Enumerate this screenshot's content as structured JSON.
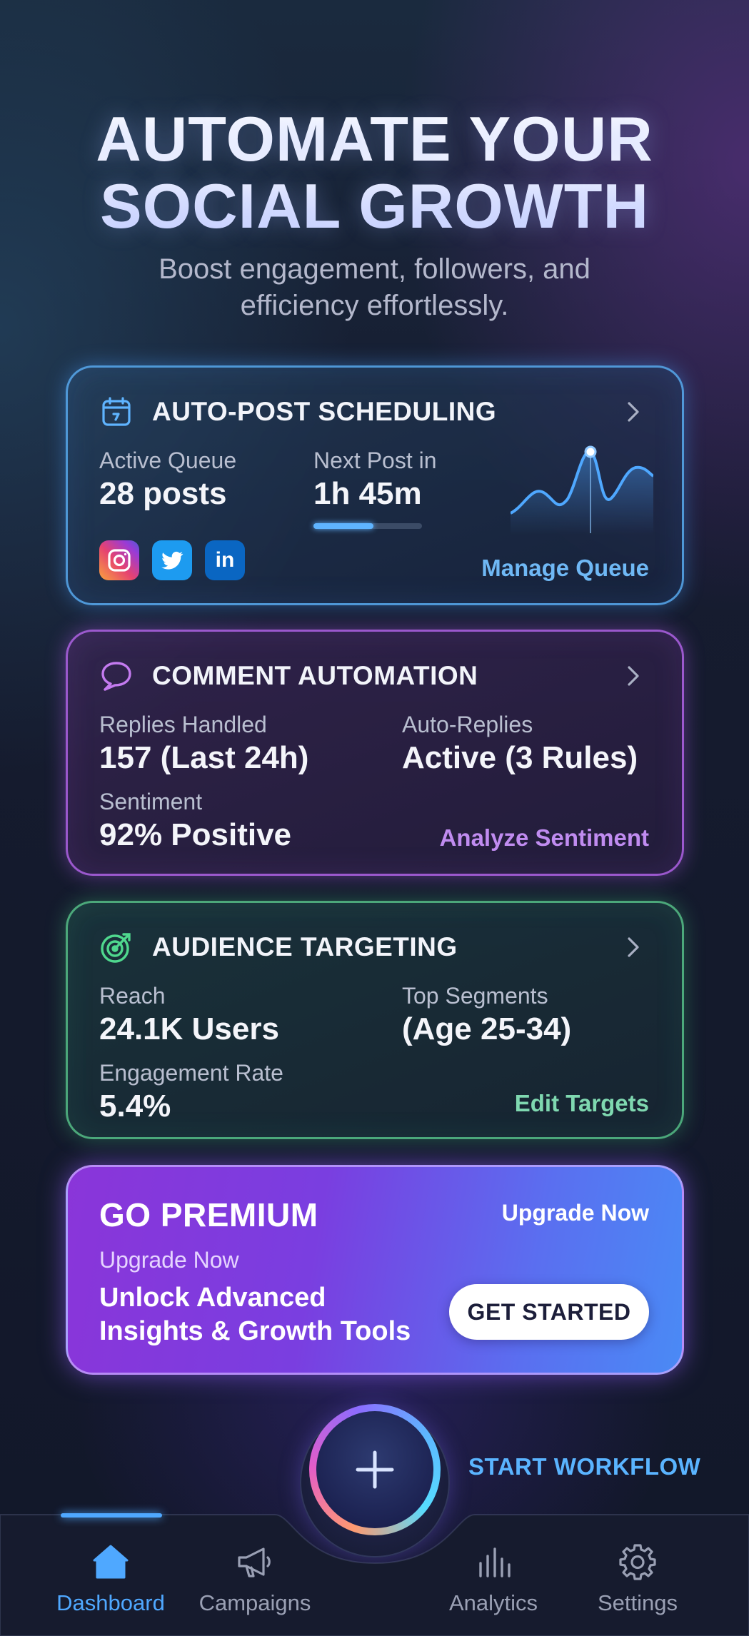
{
  "hero": {
    "title_line1": "AUTOMATE YOUR",
    "title_line2": "SOCIAL GROWTH",
    "subtitle": "Boost engagement, followers, and efficiency effortlessly."
  },
  "cards": {
    "scheduling": {
      "title": "AUTO-POST SCHEDULING",
      "icon": "calendar-icon",
      "accent": "#58aaf0",
      "queue_label": "Active Queue",
      "queue_value": "28 posts",
      "next_label": "Next Post in",
      "next_value": "1h 45m",
      "next_progress": 0.55,
      "social_icons": [
        "instagram-icon",
        "twitter-icon",
        "linkedin-icon"
      ],
      "linkedin_text": "in",
      "link": "Manage Queue"
    },
    "comments": {
      "title": "COMMENT AUTOMATION",
      "icon": "chat-bubble-icon",
      "accent": "#b064e6",
      "replies_label": "Replies Handled",
      "replies_value": "157 (Last 24h)",
      "auto_label": "Auto-Replies",
      "auto_value": "Active (3 Rules)",
      "sentiment_label": "Sentiment",
      "sentiment_value": "92% Positive",
      "link": "Analyze Sentiment"
    },
    "targeting": {
      "title": "AUDIENCE TARGETING",
      "icon": "target-icon",
      "accent": "#5ac88c",
      "reach_label": "Reach",
      "reach_value": "24.1K Users",
      "segments_label": "Top Segments",
      "segments_value": "(Age 25-34)",
      "engagement_label": "Engagement Rate",
      "engagement_value": "5.4%",
      "link": "Edit Targets"
    }
  },
  "premium": {
    "title": "GO PREMIUM",
    "top_link": "Upgrade Now",
    "subtitle": "Upgrade Now",
    "description": "Unlock Advanced Insights & Growth Tools",
    "button": "GET STARTED"
  },
  "fab": {
    "icon": "plus-icon",
    "label": "START WORKFLOW"
  },
  "nav": {
    "items": [
      {
        "label": "Dashboard",
        "icon": "home-icon",
        "active": true
      },
      {
        "label": "Campaigns",
        "icon": "megaphone-icon",
        "active": false
      },
      {
        "label": "Analytics",
        "icon": "bar-chart-icon",
        "active": false
      },
      {
        "label": "Settings",
        "icon": "gear-icon",
        "active": false
      }
    ]
  }
}
